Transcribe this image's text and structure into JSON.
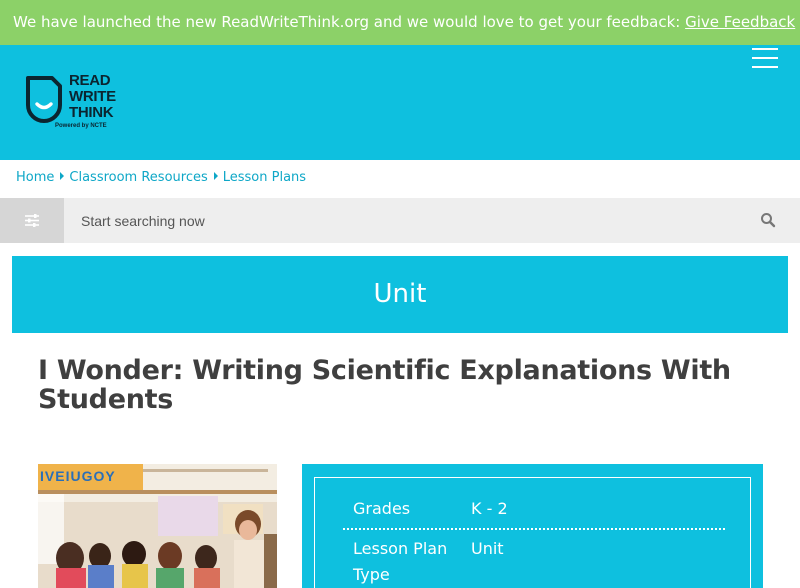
{
  "banner": {
    "text": "We have launched the new ReadWriteThink.org and we would love to get your feedback: ",
    "link_label": "Give Feedback"
  },
  "logo": {
    "line1": "READ",
    "line2": "WRITE",
    "line3": "THINK",
    "subtitle": "Powered by NCTE"
  },
  "breadcrumb": {
    "items": [
      "Home",
      "Classroom Resources",
      "Lesson Plans"
    ]
  },
  "search": {
    "placeholder": "Start searching now"
  },
  "unit_banner": {
    "label": "Unit"
  },
  "page_title": "I Wonder: Writing Scientific Explanations With Students",
  "image": {
    "banner_letters": "IVEIUGOY",
    "alt": "lesson-photo"
  },
  "details": {
    "rows": [
      {
        "label": "Grades",
        "value": "K - 2"
      },
      {
        "label": "Lesson Plan Type",
        "value": "Unit"
      }
    ]
  },
  "colors": {
    "banner_green": "#8cd168",
    "brand_cyan": "#0ec0df",
    "link_cyan": "#0ea7c7",
    "title_gray": "#3f3f3f"
  }
}
